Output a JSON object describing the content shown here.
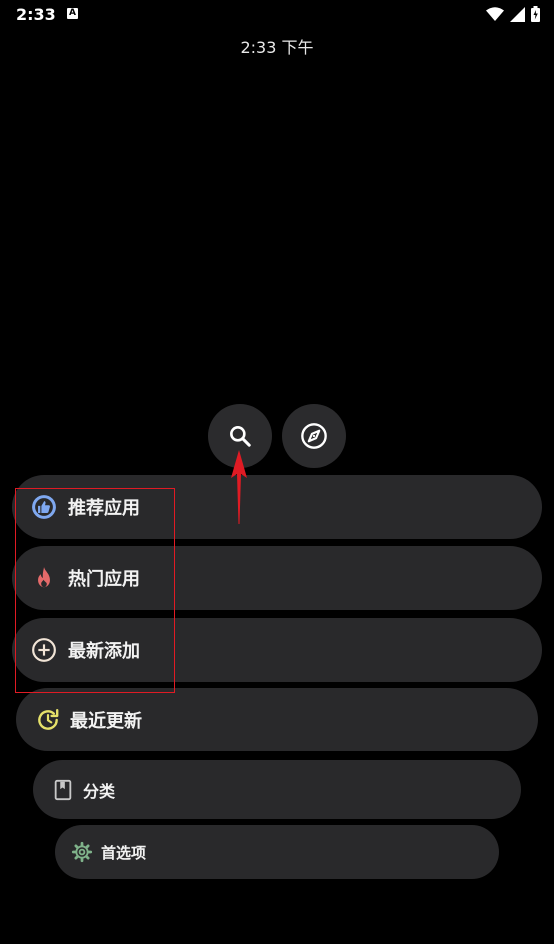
{
  "status_bar": {
    "time": "2:33",
    "notification_badge": "A"
  },
  "clock": {
    "text": "2:33 下午"
  },
  "buttons": {
    "search_icon": "search-icon",
    "explore_icon": "compass-icon"
  },
  "menu": [
    {
      "label": "推荐应用",
      "icon": "thumbs-up-icon",
      "icon_color": "#7fa8f0"
    },
    {
      "label": "热门应用",
      "icon": "fire-icon",
      "icon_color": "#e46a6a"
    },
    {
      "label": "最新添加",
      "icon": "add-circle-icon",
      "icon_color": "#f1e4d6"
    },
    {
      "label": "最近更新",
      "icon": "update-icon",
      "icon_color": "#e6e26a"
    },
    {
      "label": "分类",
      "icon": "book-icon",
      "icon_color": "#c9c9c9"
    },
    {
      "label": "首选项",
      "icon": "gear-icon",
      "icon_color": "#7fb28a"
    }
  ],
  "annotation": {
    "box_color": "#e01b24",
    "arrow_color": "#e01b24"
  }
}
